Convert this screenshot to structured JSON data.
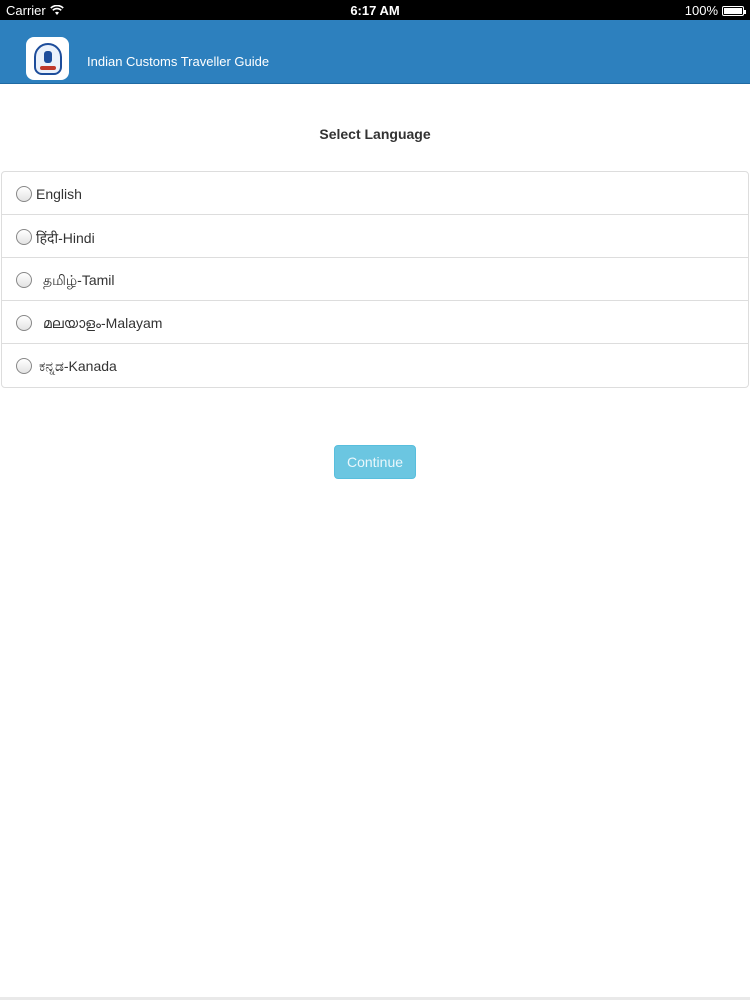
{
  "status_bar": {
    "carrier": "Carrier",
    "time": "6:17 AM",
    "battery": "100%"
  },
  "header": {
    "title": "Indian Customs Traveller Guide"
  },
  "main": {
    "title": "Select Language",
    "languages": [
      {
        "label": "English"
      },
      {
        "label": "हिंदी-Hindi"
      },
      {
        "label": "தமிழ்-Tamil"
      },
      {
        "label": "മലയാളം-Malayam"
      },
      {
        "label": "ಕನ್ನಡ-Kanada"
      }
    ],
    "continue_label": "Continue"
  }
}
